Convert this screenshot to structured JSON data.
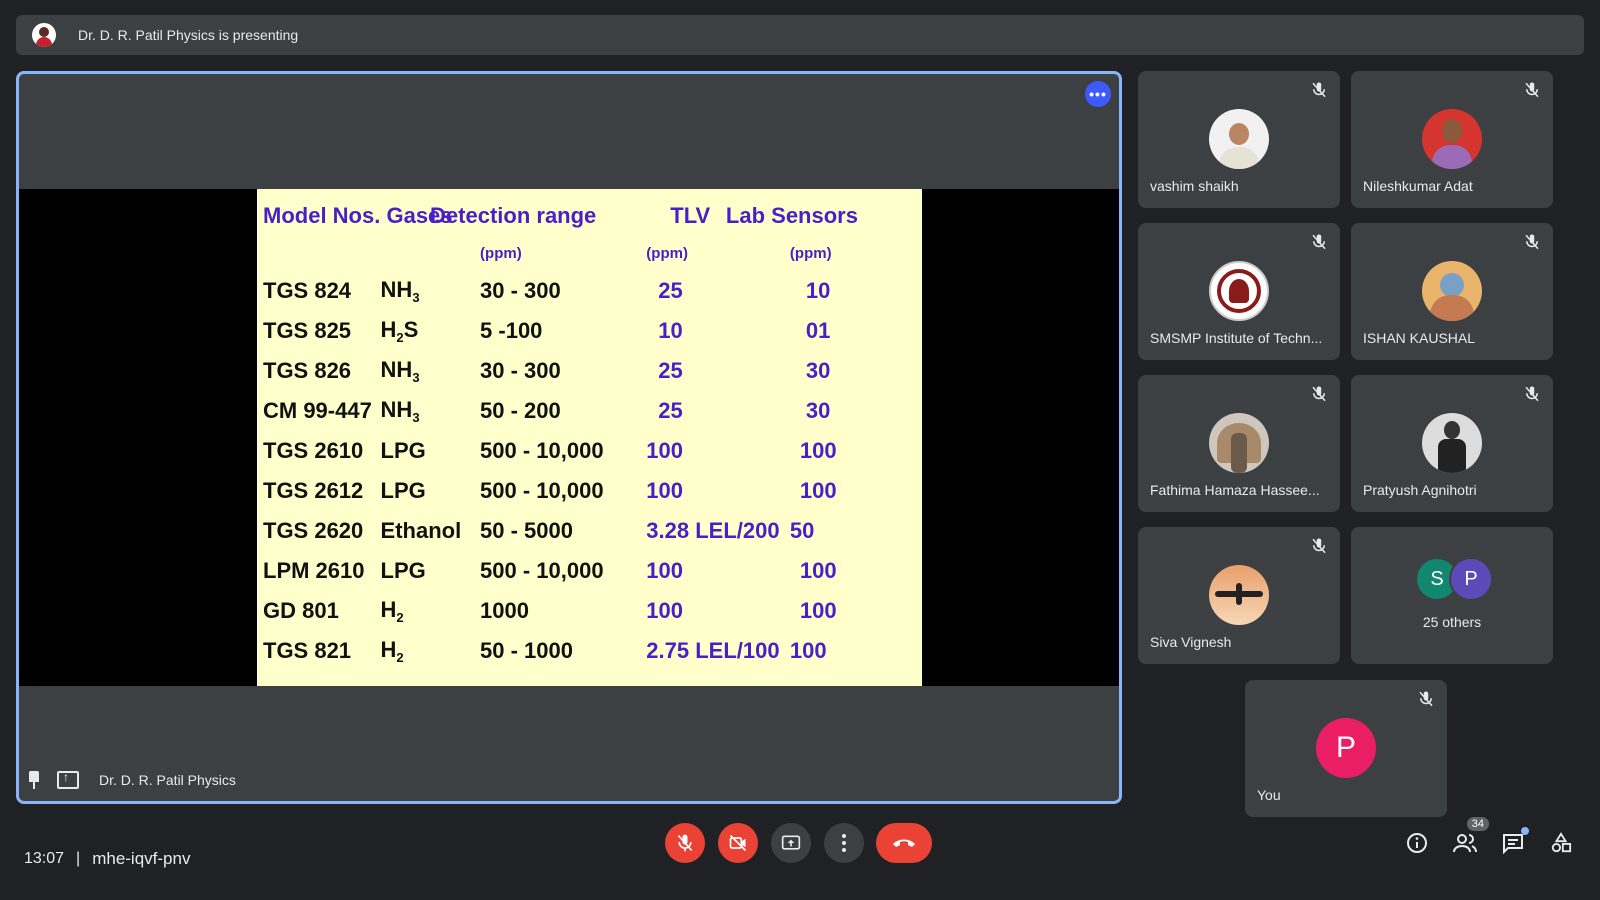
{
  "topbar": {
    "presenting_text": "Dr. D. R. Patil Physics is presenting"
  },
  "stage": {
    "presenter_name": "Dr. D. R. Patil Physics",
    "more_options": "•••"
  },
  "slide": {
    "headers": {
      "model": "Model Nos.",
      "gas": "Gases",
      "range": "Detection range",
      "tlv": "TLV",
      "lab": "Lab Sensors"
    },
    "units": {
      "range": "(ppm)",
      "tlv": "(ppm)",
      "lab": "(ppm)"
    },
    "rows": [
      {
        "model": "TGS 824",
        "gas": "NH",
        "gas_sub": "3",
        "range": "30 - 300",
        "tlv": "25",
        "lab": "10"
      },
      {
        "model": "TGS 825",
        "gas": "H",
        "gas_sub": "2",
        "gas_after": "S",
        "range": "5 -100",
        "tlv": "10",
        "lab": "01"
      },
      {
        "model": "TGS 826",
        "gas": "NH",
        "gas_sub": "3",
        "range": "30 - 300",
        "tlv": "25",
        "lab": "30"
      },
      {
        "model": "CM 99-447",
        "gas": "NH",
        "gas_sub": "3",
        "range": "50 - 200",
        "tlv": "25",
        "lab": "30"
      },
      {
        "model": "TGS 2610",
        "gas": "LPG",
        "range": "500 - 10,000",
        "tlv": "100",
        "lab": "100"
      },
      {
        "model": "TGS 2612",
        "gas": "LPG",
        "range": "500 - 10,000",
        "tlv": "100",
        "lab": "100"
      },
      {
        "model": "TGS 2620",
        "gas": "Ethanol",
        "range": "50 - 5000",
        "tlv": "3.28 LEL/200",
        "lab": "50"
      },
      {
        "model": "LPM 2610",
        "gas": "LPG",
        "range": "500 - 10,000",
        "tlv": "100",
        "lab": "100"
      },
      {
        "model": "GD 801",
        "gas": "H",
        "gas_sub": "2",
        "range": "1000",
        "tlv": "100",
        "lab": "100"
      },
      {
        "model": "TGS 821",
        "gas": "H",
        "gas_sub": "2",
        "range": "50 - 1000",
        "tlv": "2.75 LEL/100",
        "lab": "100"
      }
    ]
  },
  "participants": [
    {
      "name": "vashim shaikh"
    },
    {
      "name": "Nileshkumar Adat"
    },
    {
      "name": "SMSMP Institute of Techn..."
    },
    {
      "name": "ISHAN KAUSHAL"
    },
    {
      "name": "Fathima Hamaza Hassee..."
    },
    {
      "name": "Pratyush Agnihotri"
    },
    {
      "name": "Siva Vignesh"
    }
  ],
  "others": {
    "label": "25 others",
    "avatar1": "S",
    "avatar2": "P",
    "avatar1_color": "#12876f",
    "avatar2_color": "#5c4ab8"
  },
  "you": {
    "label": "You",
    "initial": "P",
    "color": "#e91e63"
  },
  "bottom": {
    "time": "13:07",
    "separator": "|",
    "meeting_code": "mhe-iqvf-pnv",
    "people_count": "34"
  },
  "colors": {
    "accent": "#8ab4f8",
    "danger": "#ea4335",
    "slide_bg": "#ffffcc",
    "slide_header": "#4a1ec8"
  }
}
